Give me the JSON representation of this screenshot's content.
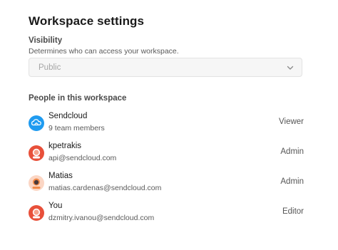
{
  "title": "Workspace settings",
  "visibility": {
    "label": "Visibility",
    "help": "Determines who can access your workspace.",
    "selected": "Public",
    "chevron_icon": "chevron-down-icon"
  },
  "people": {
    "label": "People in this workspace",
    "members": [
      {
        "name": "Sendcloud",
        "detail": "9 team members",
        "role": "Viewer",
        "avatar": "sendcloud-logo-icon",
        "avatar_color": "#1f9bf0"
      },
      {
        "name": "kpetrakis",
        "detail": "api@sendcloud.com",
        "role": "Admin",
        "avatar": "user-avatar-icon",
        "avatar_color": "#e8503a"
      },
      {
        "name": "Matias",
        "detail": "matias.cardenas@sendcloud.com",
        "role": "Admin",
        "avatar": "user-avatar-icon",
        "avatar_color": "#f28b4a"
      },
      {
        "name": "You",
        "detail": "dzmitry.ivanou@sendcloud.com",
        "role": "Editor",
        "avatar": "user-avatar-icon",
        "avatar_color": "#e8503a"
      }
    ]
  }
}
